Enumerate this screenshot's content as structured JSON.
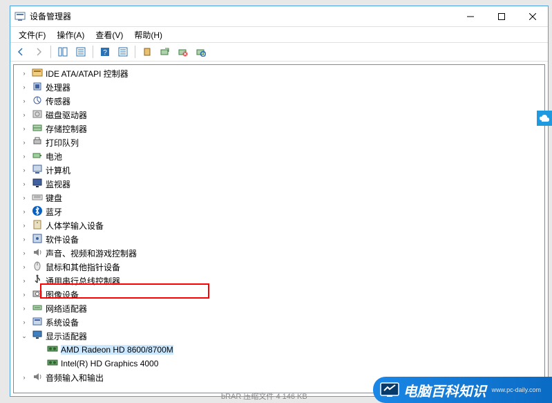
{
  "window": {
    "title": "设备管理器"
  },
  "menu": {
    "file": "文件(F)",
    "action": "操作(A)",
    "view": "查看(V)",
    "help": "帮助(H)"
  },
  "tree": {
    "categories": [
      {
        "label": "IDE ATA/ATAPI 控制器",
        "expanded": false,
        "icon": "ide"
      },
      {
        "label": "处理器",
        "expanded": false,
        "icon": "cpu"
      },
      {
        "label": "传感器",
        "expanded": false,
        "icon": "sensor"
      },
      {
        "label": "磁盘驱动器",
        "expanded": false,
        "icon": "disk"
      },
      {
        "label": "存储控制器",
        "expanded": false,
        "icon": "storage"
      },
      {
        "label": "打印队列",
        "expanded": false,
        "icon": "printer"
      },
      {
        "label": "电池",
        "expanded": false,
        "icon": "battery"
      },
      {
        "label": "计算机",
        "expanded": false,
        "icon": "computer"
      },
      {
        "label": "监视器",
        "expanded": false,
        "icon": "monitor"
      },
      {
        "label": "键盘",
        "expanded": false,
        "icon": "keyboard"
      },
      {
        "label": "蓝牙",
        "expanded": false,
        "icon": "bluetooth"
      },
      {
        "label": "人体学输入设备",
        "expanded": false,
        "icon": "hid"
      },
      {
        "label": "软件设备",
        "expanded": false,
        "icon": "software"
      },
      {
        "label": "声音、视频和游戏控制器",
        "expanded": false,
        "icon": "audio"
      },
      {
        "label": "鼠标和其他指针设备",
        "expanded": false,
        "icon": "mouse"
      },
      {
        "label": "通用串行总线控制器",
        "expanded": false,
        "icon": "usb"
      },
      {
        "label": "图像设备",
        "expanded": false,
        "icon": "camera"
      },
      {
        "label": "网络适配器",
        "expanded": false,
        "icon": "network"
      },
      {
        "label": "系统设备",
        "expanded": false,
        "icon": "system"
      },
      {
        "label": "显示适配器",
        "expanded": true,
        "icon": "display",
        "children": [
          {
            "label": "AMD Radeon HD 8600/8700M",
            "selected": true
          },
          {
            "label": "Intel(R) HD Graphics 4000",
            "selected": false
          }
        ]
      },
      {
        "label": "音频输入和输出",
        "expanded": false,
        "icon": "audio"
      }
    ]
  },
  "watermark": {
    "text": "电脑百科知识",
    "url": "www.pc-daily.com"
  },
  "status_hint": "bRAR 压缩文件    4 146 KB"
}
